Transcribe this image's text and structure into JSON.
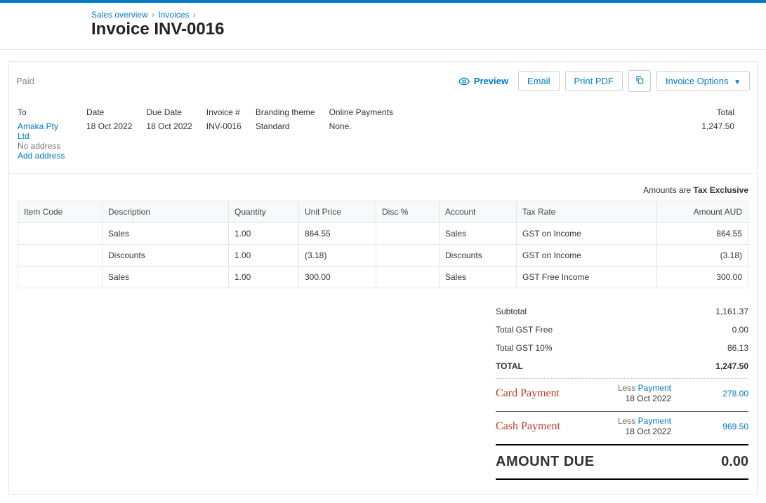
{
  "breadcrumb": {
    "sales_overview": "Sales overview",
    "invoices": "Invoices"
  },
  "page_title": "Invoice INV-0016",
  "status": "Paid",
  "actions": {
    "preview": "Preview",
    "email": "Email",
    "print_pdf": "Print PDF",
    "invoice_options": "Invoice Options"
  },
  "header": {
    "labels": {
      "to": "To",
      "date": "Date",
      "due_date": "Due Date",
      "invoice_no": "Invoice #",
      "branding": "Branding theme",
      "online_payments": "Online Payments",
      "total": "Total"
    },
    "to": {
      "name": "Amaka Pty Ltd",
      "no_address": "No address",
      "add_address": "Add address"
    },
    "date": "18 Oct 2022",
    "due_date": "18 Oct 2022",
    "invoice_no": "INV-0016",
    "branding": "Standard",
    "online_payments": "None.",
    "total": "1,247.50"
  },
  "amounts_note_prefix": "Amounts are ",
  "amounts_note_bold": "Tax Exclusive",
  "columns": {
    "item_code": "Item Code",
    "description": "Description",
    "quantity": "Quantity",
    "unit_price": "Unit Price",
    "disc": "Disc %",
    "account": "Account",
    "tax_rate": "Tax Rate",
    "amount": "Amount AUD"
  },
  "lines": [
    {
      "item_code": "",
      "description": "Sales",
      "quantity": "1.00",
      "unit_price": "864.55",
      "disc": "",
      "account": "Sales",
      "tax_rate": "GST on Income",
      "amount": "864.55"
    },
    {
      "item_code": "",
      "description": "Discounts",
      "quantity": "1.00",
      "unit_price": "(3.18)",
      "disc": "",
      "account": "Discounts",
      "tax_rate": "GST on Income",
      "amount": "(3.18)"
    },
    {
      "item_code": "",
      "description": "Sales",
      "quantity": "1.00",
      "unit_price": "300.00",
      "disc": "",
      "account": "Sales",
      "tax_rate": "GST Free Income",
      "amount": "300.00"
    }
  ],
  "totals": {
    "subtotal_label": "Subtotal",
    "subtotal": "1,161.37",
    "gst_free_label": "Total GST Free",
    "gst_free": "0.00",
    "gst_label": "Total GST  10%",
    "gst": "86.13",
    "total_label": "TOTAL",
    "total": "1,247.50",
    "less_word": "Less ",
    "payment_word": "Payment",
    "payments": [
      {
        "annotation": "Card Payment",
        "date": "18 Oct 2022",
        "amount": "278.00"
      },
      {
        "annotation": "Cash Payment",
        "date": "18 Oct 2022",
        "amount": "969.50"
      }
    ],
    "due_label": "AMOUNT DUE",
    "due": "0.00"
  }
}
